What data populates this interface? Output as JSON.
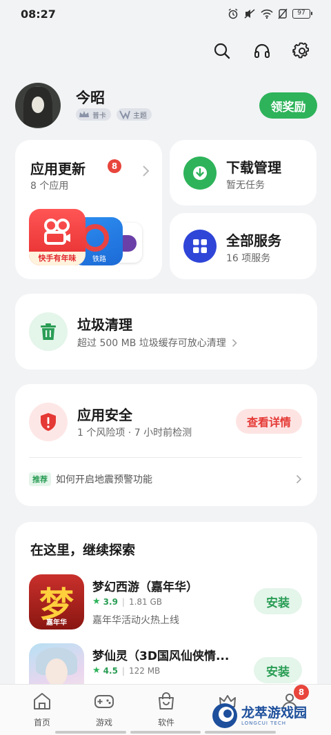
{
  "status_bar": {
    "time": "08:27",
    "battery": "97"
  },
  "profile": {
    "name": "今昭",
    "badge1": "普卡",
    "badge2": "主题",
    "reward_button": "领奖励"
  },
  "update_card": {
    "title": "应用更新",
    "badge_count": "8",
    "subtitle": "8 个应用",
    "apps": [
      {
        "label": "快手有年味"
      },
      {
        "label": "铁路"
      }
    ]
  },
  "download_card": {
    "title": "下载管理",
    "subtitle": "暂无任务"
  },
  "services_card": {
    "title": "全部服务",
    "subtitle": "16 项服务"
  },
  "trash_card": {
    "title": "垃圾清理",
    "subtitle": "超过 500 MB 垃圾缓存可放心清理"
  },
  "security_card": {
    "title": "应用安全",
    "subtitle": "1 个风险项 · 7 小时前检测",
    "button": "查看详情",
    "tip_tag": "推荐",
    "tip_text": "如何开启地震预警功能"
  },
  "explore": {
    "title": "在这里，继续探索",
    "apps": [
      {
        "name": "梦幻西游（嘉年华）",
        "rating": "3.9",
        "size": "1.81 GB",
        "desc": "嘉年华活动火热上线",
        "install": "安装",
        "icon_glyph": "梦",
        "icon_caption": "嘉年华"
      },
      {
        "name": "梦仙灵（3D国风仙侠情...",
        "rating": "4.5",
        "size": "122 MB",
        "desc": "",
        "install": "安装"
      }
    ]
  },
  "nav": {
    "home": "首页",
    "games": "游戏",
    "software": "软件",
    "badge": "8"
  },
  "watermark": {
    "title": "龙萃游戏园",
    "subtitle": "LONGCUI TECH"
  }
}
